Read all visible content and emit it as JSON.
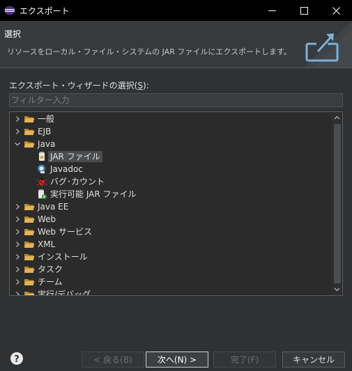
{
  "window": {
    "title": "エクスポート",
    "minimize": "—",
    "maximize": "☐",
    "close": "✕"
  },
  "banner": {
    "heading": "選択",
    "description": "リソースをローカル・ファイル・システムの JAR ファイルにエクスポートします。"
  },
  "wizard": {
    "label_prefix": "エクスポート・ウィザードの選択(",
    "label_mnemonic": "S",
    "label_suffix": "):",
    "filter_placeholder": "フィルター入力"
  },
  "tree": {
    "items": [
      {
        "label": "一般",
        "kind": "folder",
        "state": "collapsed"
      },
      {
        "label": "EJB",
        "kind": "folder",
        "state": "collapsed"
      },
      {
        "label": "Java",
        "kind": "folder",
        "state": "expanded"
      },
      {
        "label": "JAR ファイル",
        "kind": "jar",
        "state": "leaf",
        "selected": true
      },
      {
        "label": "Javadoc",
        "kind": "javadoc",
        "state": "leaf"
      },
      {
        "label": "バグ･カウント",
        "kind": "bug",
        "state": "leaf"
      },
      {
        "label": "実行可能 JAR ファイル",
        "kind": "runnable-jar",
        "state": "leaf"
      },
      {
        "label": "Java EE",
        "kind": "folder",
        "state": "collapsed"
      },
      {
        "label": "Web",
        "kind": "folder",
        "state": "collapsed"
      },
      {
        "label": "Web サービス",
        "kind": "folder",
        "state": "collapsed"
      },
      {
        "label": "XML",
        "kind": "folder",
        "state": "collapsed"
      },
      {
        "label": "インストール",
        "kind": "folder",
        "state": "collapsed"
      },
      {
        "label": "タスク",
        "kind": "folder",
        "state": "collapsed"
      },
      {
        "label": "チーム",
        "kind": "folder",
        "state": "collapsed"
      },
      {
        "label": "実行/デバッグ",
        "kind": "folder",
        "state": "collapsed"
      }
    ]
  },
  "buttons": {
    "back": "< 戻る(B)",
    "next": "次へ(N) >",
    "finish": "完了(F)",
    "cancel": "キャンセル"
  },
  "colors": {
    "accent": "#5aa0d8",
    "folder": "#d9a94a",
    "background": "#2f3133"
  }
}
